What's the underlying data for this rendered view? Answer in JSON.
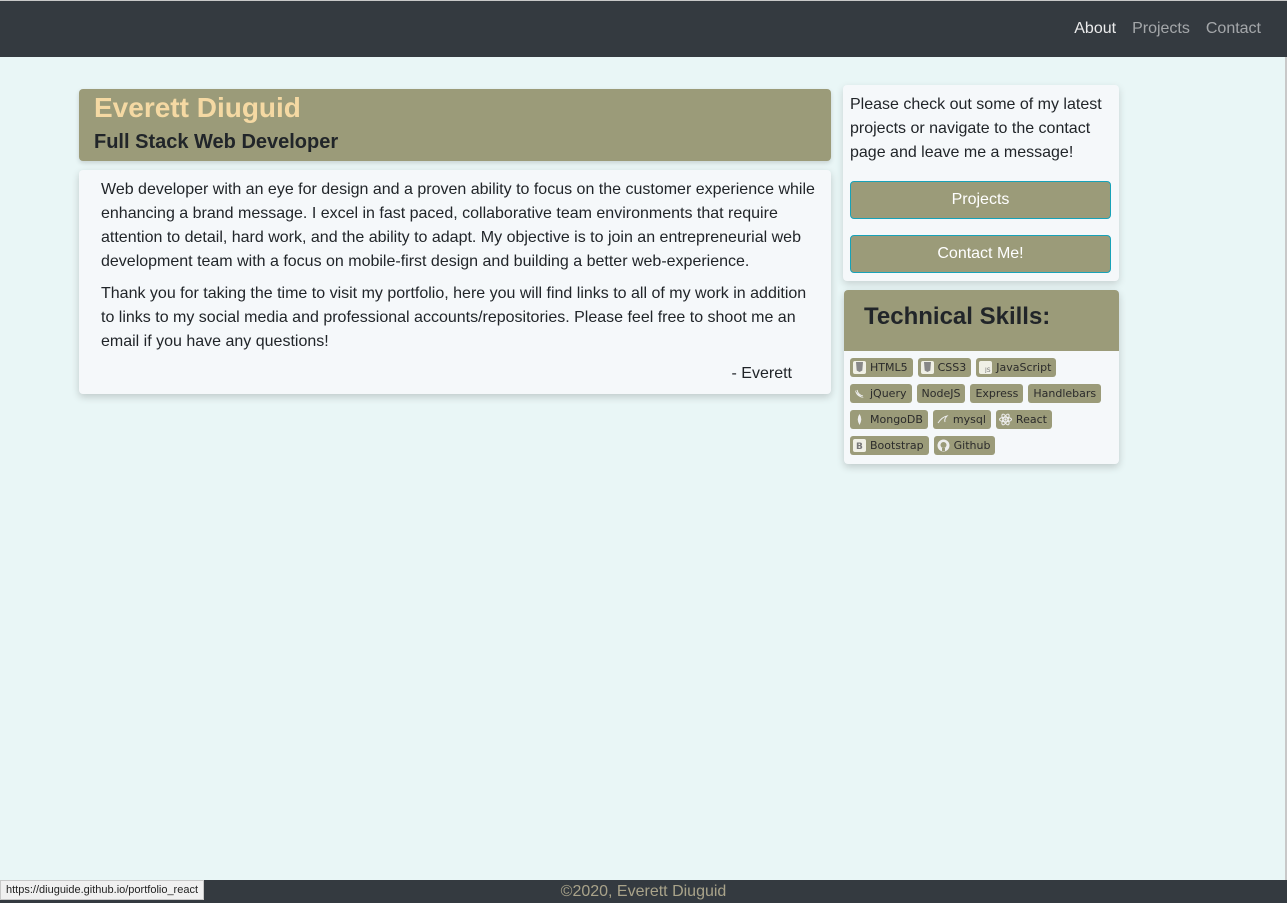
{
  "nav": {
    "links": [
      {
        "label": "About",
        "active": true
      },
      {
        "label": "Projects",
        "active": false
      },
      {
        "label": "Contact",
        "active": false
      }
    ]
  },
  "hero": {
    "name": "Everett Diuguid",
    "title": "Full Stack Web Developer"
  },
  "about": {
    "paragraph1": "Web developer with an eye for design and a proven ability to focus on the customer experience while enhancing a brand message. I excel in fast paced, collaborative team environments that require attention to detail, hard work, and the ability to adapt. My objective is to join an entrepreneurial web development team with a focus on mobile-first design and building a better web-experience.",
    "paragraph2": "Thank you for taking the time to visit my portfolio, here you will find links to all of my work in addition to links to my social media and professional accounts/repositories. Please feel free to shoot me an email if you have any questions!",
    "signature": "- Everett"
  },
  "cta": {
    "text": "Please check out some of my latest projects or navigate to the contact page and leave me a message!",
    "projects_label": "Projects",
    "contact_label": "Contact Me!"
  },
  "skills": {
    "title": "Technical Skills:",
    "items": [
      {
        "label": "HTML5",
        "icon": "html5-icon"
      },
      {
        "label": "CSS3",
        "icon": "css3-icon"
      },
      {
        "label": "JavaScript",
        "icon": "javascript-icon"
      },
      {
        "label": "jQuery",
        "icon": "jquery-icon"
      },
      {
        "label": "NodeJS",
        "icon": ""
      },
      {
        "label": "Express",
        "icon": ""
      },
      {
        "label": "Handlebars",
        "icon": ""
      },
      {
        "label": "MongoDB",
        "icon": "mongodb-icon"
      },
      {
        "label": "mysql",
        "icon": "mysql-icon"
      },
      {
        "label": "React",
        "icon": "react-icon"
      },
      {
        "label": "Bootstrap",
        "icon": "bootstrap-icon"
      },
      {
        "label": "Github",
        "icon": "github-icon"
      }
    ]
  },
  "footer": {
    "text": "©2020, Everett Diuguid"
  },
  "status_bar": {
    "url": "https://diuguide.github.io/portfolio_react"
  },
  "colors": {
    "navbar": "#343a40",
    "background": "#e9f6f6",
    "accent": "#9b9b79",
    "name": "#f5d9a3",
    "button_border": "#17a2b8"
  }
}
